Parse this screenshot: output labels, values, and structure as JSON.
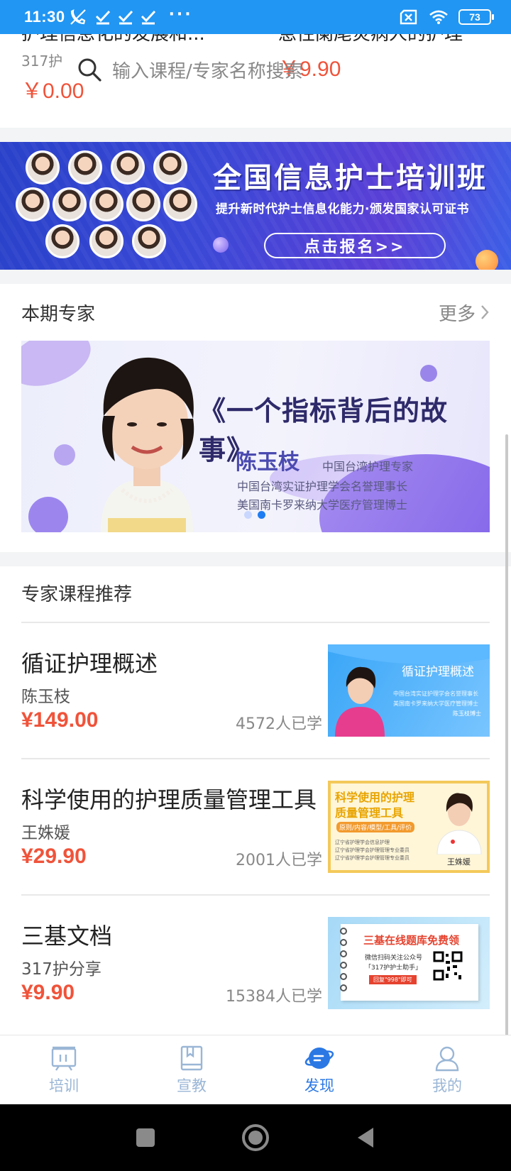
{
  "status_bar": {
    "time": "11:30",
    "dots": "···",
    "battery": "73"
  },
  "top_products": [
    {
      "title": "护理信息化的发展和...",
      "sub": "317护",
      "price": "￥0.00"
    },
    {
      "title": "急性阑尾炎病人的护理",
      "sub": "",
      "price": "￥9.90"
    }
  ],
  "search": {
    "placeholder": "输入课程/专家名称搜索"
  },
  "banner": {
    "title": "全国信息护士培训班",
    "subtitle": "提升新时代护士信息化能力·颁发国家认可证书",
    "button": "点击报名>>"
  },
  "experts_section": {
    "title": "本期专家",
    "more": "更多",
    "card": {
      "headline": "《一个指标背后的故事》",
      "name": "陈玉枝",
      "role": "中国台湾护理专家",
      "line2": "中国台湾实证护理学会名誉理事长",
      "line3": "美国南卡罗来纳大学医疗管理博士"
    },
    "carousel_count": 2,
    "carousel_active": 1
  },
  "courses_section": {
    "title": "专家课程推荐",
    "items": [
      {
        "name": "循证护理概述",
        "author": "陈玉枝",
        "price": "¥149.00",
        "learners": "4572人已学",
        "thumb": {
          "title": "循证护理概述",
          "l1": "中国台湾实证护理学会名誉理事长",
          "l2": "美国南卡罗来纳大学医疗管理博士",
          "l3": "陈玉枝博士"
        }
      },
      {
        "name": "科学使用的护理质量管理工具",
        "author": "王姝媛",
        "price": "¥29.90",
        "learners": "2001人已学",
        "thumb": {
          "title1": "科学使用的护理",
          "title2": "质量管理工具",
          "tag": "原则/内容/模型/工具/评价",
          "l1": "辽宁省护理学会信息护理",
          "l2": "辽宁省护理学会护理管理专业委员",
          "l3": "辽宁省护理学会护理管理专业委员",
          "name": "王姝媛"
        }
      },
      {
        "name": "三基文档",
        "author": "317护分享",
        "price": "¥9.90",
        "learners": "15384人已学",
        "thumb": {
          "title": "三基在线题库免费领",
          "l1": "微信扫码关注公众号",
          "l2": "「317护护士助手」",
          "btn": "回复\"998\"即可"
        }
      }
    ]
  },
  "tabbar": [
    {
      "label": "培训",
      "icon": "training-icon",
      "active": false
    },
    {
      "label": "宣教",
      "icon": "book-icon",
      "active": false
    },
    {
      "label": "发现",
      "icon": "discover-icon",
      "active": true
    },
    {
      "label": "我的",
      "icon": "profile-icon",
      "active": false
    }
  ],
  "colors": {
    "status_bar": "#2196f3",
    "price": "#f0533a",
    "tab_active": "#2b78e4",
    "tab_inactive": "#9ab6d6"
  }
}
